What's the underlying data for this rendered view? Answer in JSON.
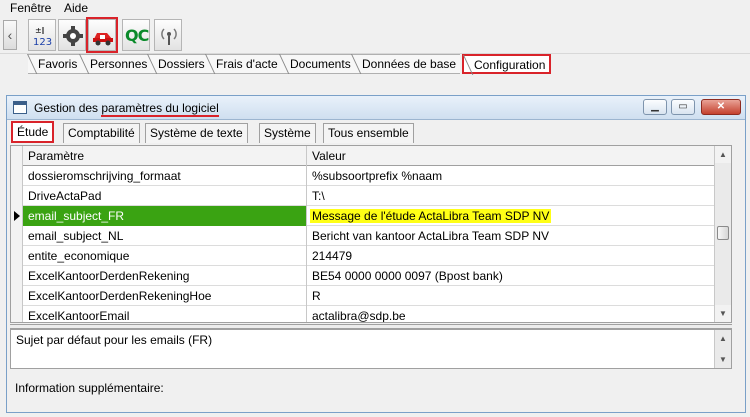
{
  "menu": [
    "Fenêtre",
    "Aide"
  ],
  "toolbar": {
    "buttons": [
      {
        "icon": "calculator-icon",
        "text": "123"
      },
      {
        "icon": "gear-settings-icon"
      },
      {
        "icon": "car-config-icon"
      },
      {
        "icon": "qc-icon",
        "text": "QC"
      },
      {
        "icon": "wireless-signal-icon"
      }
    ]
  },
  "main_tabs": [
    "Favoris",
    "Personnes",
    "Dossiers",
    "Frais d'acte",
    "Documents",
    "Données de base",
    "Configuration"
  ],
  "active_main_tab": "Configuration",
  "window": {
    "title": "Gestion des paramètres du logiciel",
    "controls": [
      "minimize",
      "maximize",
      "close"
    ]
  },
  "sub_tabs": [
    "Étude",
    "Comptabilité",
    "Système de texte",
    "Système",
    "Tous ensemble"
  ],
  "active_sub_tab": "Étude",
  "grid": {
    "columns": [
      "Paramètre",
      "Valeur"
    ],
    "rows": [
      {
        "param": "dossieromschrijving_formaat",
        "value": "%subsoortprefix %naam"
      },
      {
        "param": "DriveActaPad",
        "value": "T:\\"
      },
      {
        "param": "email_subject_FR",
        "value": "Message de l'étude ActaLibra Team SDP NV"
      },
      {
        "param": "email_subject_NL",
        "value": "Bericht van kantoor ActaLibra Team SDP NV"
      },
      {
        "param": "entite_economique",
        "value": "214479"
      },
      {
        "param": "ExcelKantoorDerdenRekening",
        "value": "BE54 0000 0000 0097 (Bpost bank)"
      },
      {
        "param": "ExcelKantoorDerdenRekeningHoe",
        "value": "R"
      },
      {
        "param": "ExcelKantoorEmail",
        "value": "actalibra@sdp.be"
      }
    ],
    "selected_row": 2
  },
  "description": "Sujet par défaut pour les emails (FR)",
  "info_label": "Information supplémentaire:",
  "colors": {
    "highlight_red": "#d9232a",
    "selected_param_bg": "#3aa312",
    "selected_value_bg": "#ffff16"
  }
}
